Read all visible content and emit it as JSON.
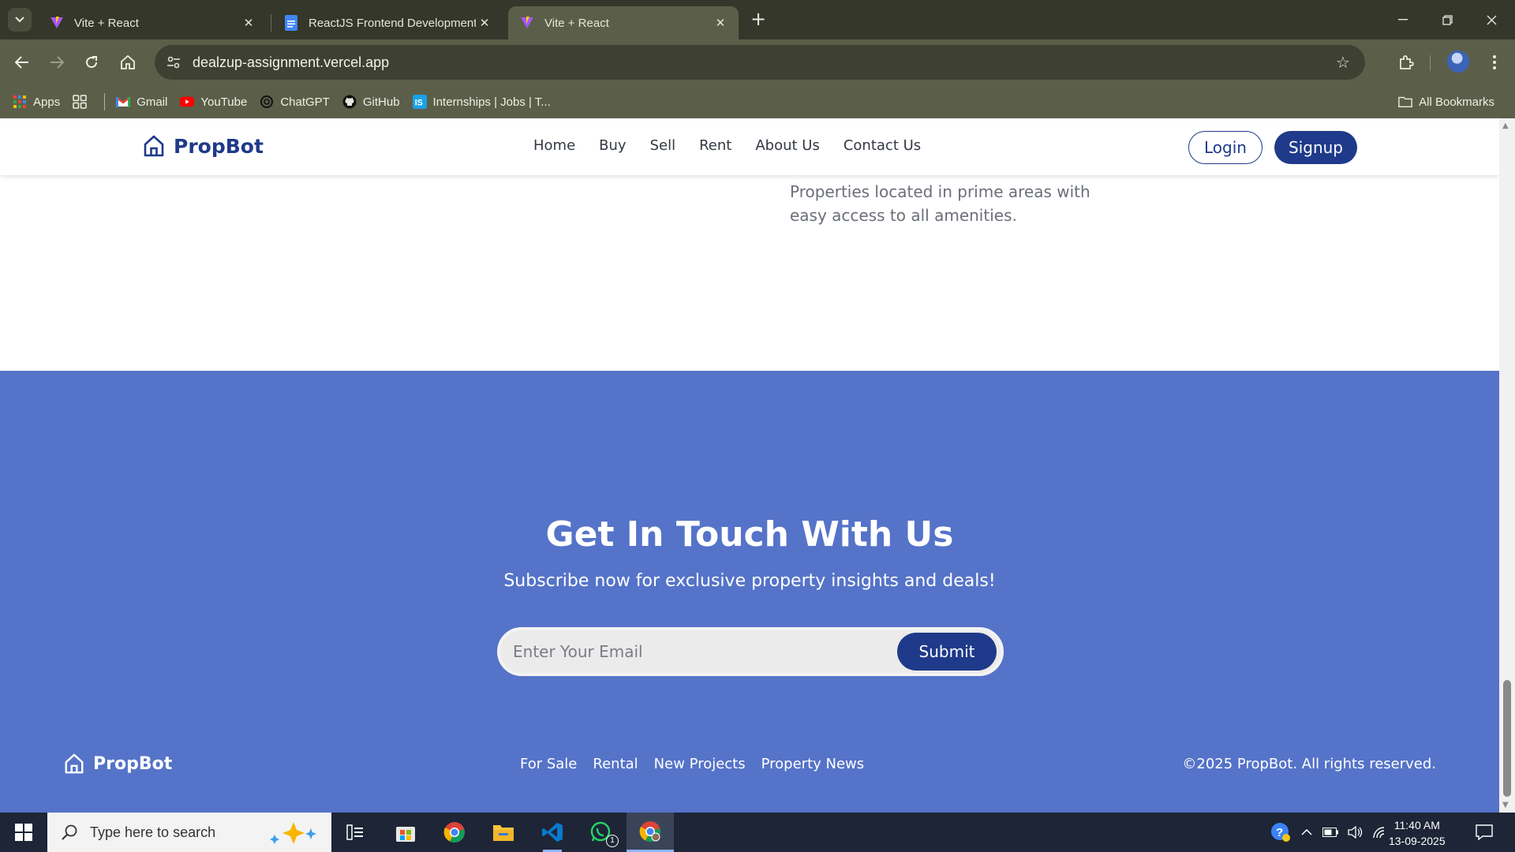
{
  "browser": {
    "tabs": [
      {
        "title": "Vite + React",
        "active": false
      },
      {
        "title": "ReactJS Frontend Development",
        "active": false
      },
      {
        "title": "Vite + React",
        "active": true
      }
    ],
    "url": "dealzup-assignment.vercel.app",
    "bookmarks": [
      {
        "label": "Apps",
        "icon": "apps-grid-icon"
      },
      {
        "label": "",
        "icon": "tab-groups-icon"
      },
      {
        "label": "Gmail",
        "icon": "gmail-icon"
      },
      {
        "label": "YouTube",
        "icon": "youtube-icon"
      },
      {
        "label": "ChatGPT",
        "icon": "chatgpt-icon"
      },
      {
        "label": "GitHub",
        "icon": "github-icon"
      },
      {
        "label": "Internships | Jobs | T...",
        "icon": "internshala-icon"
      }
    ],
    "all_bookmarks_label": "All Bookmarks"
  },
  "site": {
    "brand": "PropBot",
    "nav": [
      "Home",
      "Buy",
      "Sell",
      "Rent",
      "About Us",
      "Contact Us"
    ],
    "login_label": "Login",
    "signup_label": "Signup",
    "feature_text": "Properties located in prime areas with easy access to all amenities.",
    "contact": {
      "title": "Get In Touch With Us",
      "subtitle": "Subscribe now for exclusive property insights and deals!",
      "email_placeholder": "Enter Your Email",
      "submit_label": "Submit"
    },
    "footer": {
      "brand": "PropBot",
      "links": [
        "For Sale",
        "Rental",
        "New Projects",
        "Property News"
      ],
      "copyright": "©2025 PropBot. All rights reserved."
    }
  },
  "taskbar": {
    "search_placeholder": "Type here to search",
    "whatsapp_badge": "1",
    "time": "11:40 AM",
    "date": "13-09-2025"
  },
  "colors": {
    "brand_navy": "#1f3a8a",
    "contact_bg": "#5573c8",
    "browser_frame": "#5b5f49"
  }
}
